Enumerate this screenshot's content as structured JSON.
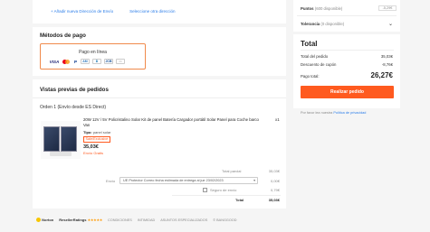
{
  "address": {
    "add_link": "+ Añadir nueva Dirección de Envío",
    "select_link": "Seleccione otra dirección"
  },
  "payment": {
    "title": "Métodos de pago",
    "option_label": "Pago en línea",
    "icons": [
      "VISA",
      "mastercard",
      "P",
      "AMEX",
      "dinners",
      "JCB",
      "card"
    ]
  },
  "orders": {
    "title": "Vistas previas de pedidos",
    "order_label": "Orden 1 (Envío desde ES Direct)",
    "product": {
      "description": "20W 12V / 5V Policristalino Solar Kit de panel Batería Cargador portátil Solar Panel para Coche barco Van",
      "type_label": "Tipo:",
      "type_value": "panel solar",
      "badge": "Sale/Exclusive",
      "price": "35,03€",
      "shipping": "Envío Gratis",
      "quantity": "x1"
    },
    "summary": {
      "total_label": "Total parcial",
      "total_value": "35,03€",
      "shipping_label": "Envío",
      "shipping_option": "UE Protector Correo fecha estimada de entrega al jue 23/02/2023",
      "shipping_value": "0,00€",
      "insurance_label": "Seguro de envío",
      "insurance_value": "0,79€",
      "grand_label": "Total",
      "grand_value": "35,03€"
    }
  },
  "sidebar": {
    "points_label": "Puntos",
    "points_detail": "(600 disponible)",
    "points_input": "-5,29€",
    "tolerance_label": "Tolerancia",
    "tolerance_detail": "(0 disponible)",
    "total_title": "Total",
    "rows": [
      {
        "label": "Total del pedido",
        "value": "35,03€"
      },
      {
        "label": "Descuento de cupón",
        "value": "-8,76€"
      }
    ],
    "pay_total_label": "Pago total:",
    "pay_total_value": "26,27€",
    "pay_button": "Realizar pedido",
    "privacy_prefix": "Por favor lea nuestra",
    "privacy_link": "Política de privacidad"
  },
  "footer": {
    "norton": "Norton",
    "reseller": "ResellerRatings",
    "links": [
      "CONDICIONES",
      "INTIMIDAD",
      "ASUNTOS ESPECIALIZADOS",
      "© BANGGOOD"
    ]
  },
  "colors": {
    "accent": "#ff5a1f",
    "link": "#2b7de9"
  }
}
